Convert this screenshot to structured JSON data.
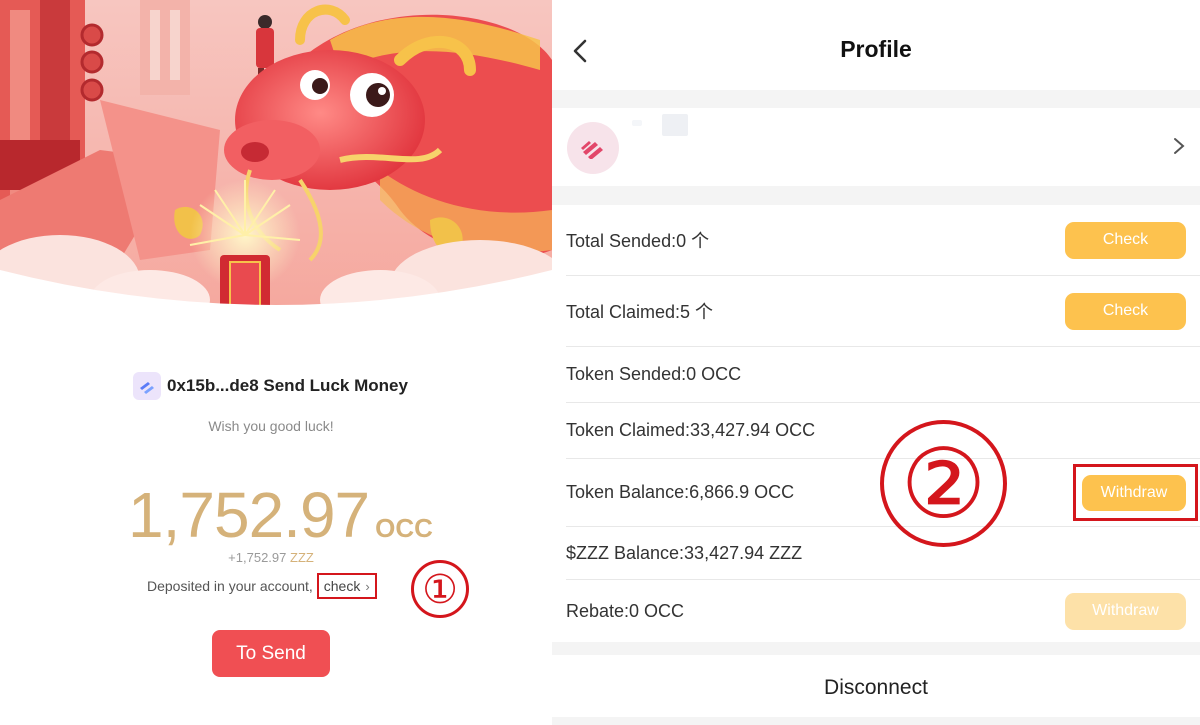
{
  "left": {
    "sender_title": "0x15b...de8 Send Luck Money",
    "wish": "Wish you good luck!",
    "amount": "1,752.97",
    "amount_unit": "OCC",
    "sub_amount_value": "+1,752.97",
    "sub_amount_unit": "ZZZ",
    "deposit_text": "Deposited in your account,",
    "check_label": "check",
    "annotation_1": "①",
    "send_button": "To Send"
  },
  "right": {
    "page_title": "Profile",
    "stats": [
      {
        "label": "Total Sended:0 个",
        "action": "Check"
      },
      {
        "label": "Total Claimed:5 个",
        "action": "Check"
      },
      {
        "label": "Token Sended:0 OCC"
      },
      {
        "label": "Token Claimed:33,427.94 OCC"
      },
      {
        "label": "Token Balance:6,866.9 OCC",
        "action": "Withdraw"
      },
      {
        "label": "$ZZZ Balance:33,427.94 ZZZ"
      },
      {
        "label": "Rebate:0 OCC",
        "action": "Withdraw"
      }
    ],
    "annotation_2": "②",
    "disconnect": "Disconnect"
  },
  "icons": {
    "back": "chevron-left-icon",
    "card_arrow": "chevron-right-icon",
    "check_arrow": "chevron-right-icon"
  },
  "colors": {
    "accent_gold": "#d5b27a",
    "pill_yellow": "#fdc24e",
    "send_red": "#f04f53",
    "annotation_red": "#d4161c"
  }
}
